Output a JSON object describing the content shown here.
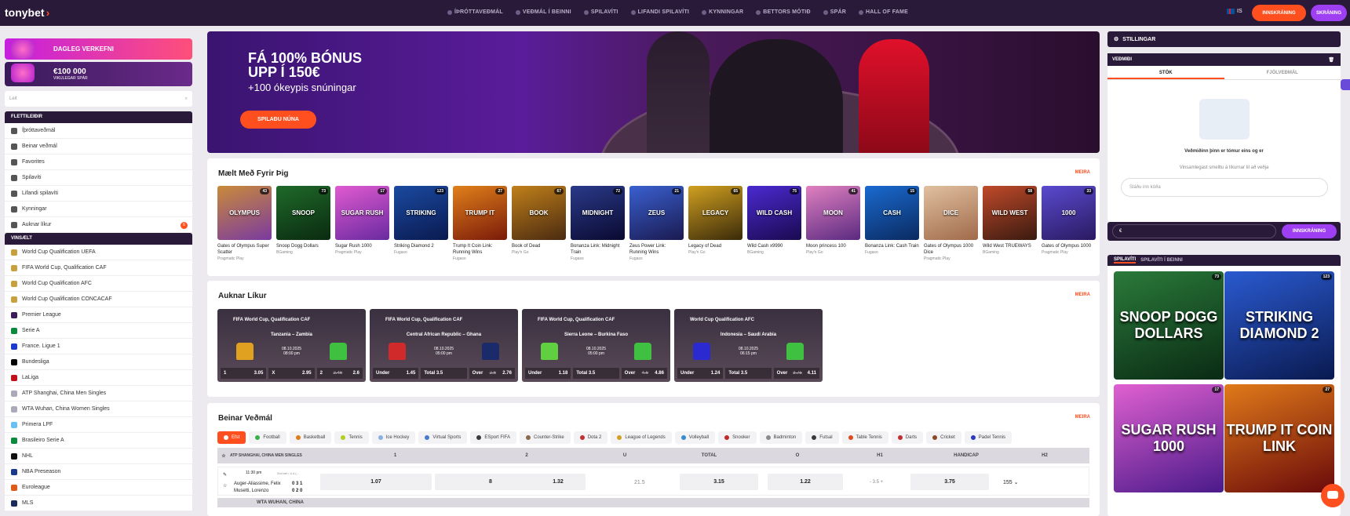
{
  "header": {
    "logo": "tonybet",
    "nav": [
      "ÍÞRÓTTAVEÐMÁL",
      "VEÐMÁL Í BEINNI",
      "SPILAVÍTI",
      "LIFANDI SPILAVÍTI",
      "KYNNINGAR",
      "BETTORS MÓTIÐ",
      "SPÁR",
      "HALL OF FAME"
    ],
    "lang": "IS",
    "login": "INNSKRÁNING",
    "register": "SKRÁNING"
  },
  "left": {
    "promo1": "DAGLEG VERKEFNI",
    "promo2_title": "€100 000",
    "promo2_sub": "VIKULEGAR SPÁR",
    "search_placeholder": "Leit",
    "sec1": "FLETTILEIÐIR",
    "nav_items": [
      "Íþróttaveðmál",
      "Beinar veðmál",
      "Favorites",
      "Spilavíti",
      "Lifandi spilavíti",
      "Kynningar",
      "Auknar líkur"
    ],
    "auknar_count": "6",
    "sec2": "VINSÆLT",
    "popular": [
      "World Cup Qualification UEFA",
      "FIFA World Cup, Qualification CAF",
      "World Cup Qualification AFC",
      "World Cup Qualification CONCACAF",
      "Premier League",
      "Serie A",
      "France. Ligue 1",
      "Bundesliga",
      "LaLiga",
      "ATP Shanghai, China Men Singles",
      "WTA Wuhan, China Women Singles",
      "Primera LPF",
      "Brasileiro Serie A",
      "NHL",
      "NBA Preseason",
      "Euroleague",
      "MLS"
    ]
  },
  "banner": {
    "line1": "FÁ 100% BÓNUS",
    "line2": "UPP Í 150€",
    "line3": "+100 ókeypis snúningar",
    "cta": "SPILAÐU NÚNA"
  },
  "recommended": {
    "title": "Mælt Með Fyrir Þig",
    "more": "MEIRA",
    "games": [
      {
        "name": "Gates of Olympus Super Scatter",
        "prov": "Pragmatic Play",
        "n": "43",
        "art": "OLYMPUS",
        "c1": "#c98a3a",
        "c2": "#7a3aa0"
      },
      {
        "name": "Snoop Dogg Dollars",
        "prov": "BGaming",
        "n": "73",
        "art": "SNOOP",
        "c1": "#1f6a2a",
        "c2": "#0a2a10"
      },
      {
        "name": "Sugar Rush 1000",
        "prov": "Pragmatic Play",
        "n": "17",
        "art": "SUGAR RUSH",
        "c1": "#e05ad0",
        "c2": "#6a2aa0"
      },
      {
        "name": "Striking Diamond 2",
        "prov": "Fugaso",
        "n": "123",
        "art": "STRIKING",
        "c1": "#1a4aa0",
        "c2": "#0a1a50"
      },
      {
        "name": "Trump It Coin Link: Running Wins",
        "prov": "Fugaso",
        "n": "27",
        "art": "TRUMP IT",
        "c1": "#e0801a",
        "c2": "#7a1a0a"
      },
      {
        "name": "Book of Dead",
        "prov": "Play'n Go",
        "n": "67",
        "art": "BOOK",
        "c1": "#c0801a",
        "c2": "#4a2a10"
      },
      {
        "name": "Bonanza Link: Midnight Train",
        "prov": "Fugaso",
        "n": "72",
        "art": "MIDNIGHT",
        "c1": "#2a3a8a",
        "c2": "#0a0a30"
      },
      {
        "name": "Zeus Power Link: Running Wins",
        "prov": "Fugaso",
        "n": "21",
        "art": "ZEUS",
        "c1": "#3a60d0",
        "c2": "#1a1a50"
      },
      {
        "name": "Legacy of Dead",
        "prov": "Play'n Go",
        "n": "65",
        "art": "LEGACY",
        "c1": "#d0a020",
        "c2": "#3a2a0a"
      },
      {
        "name": "Wild Cash x9990",
        "prov": "BGaming",
        "n": "75",
        "art": "WILD CASH",
        "c1": "#4a2ad0",
        "c2": "#1a0a50"
      },
      {
        "name": "Moon princess 100",
        "prov": "Play'n Go",
        "n": "41",
        "art": "MOON",
        "c1": "#e080c0",
        "c2": "#5a2a80"
      },
      {
        "name": "Bonanza Link: Cash Train",
        "prov": "Fugaso",
        "n": "15",
        "art": "CASH",
        "c1": "#1a6ad0",
        "c2": "#0a2a60"
      },
      {
        "name": "Gates of Olympus 1000 Dice",
        "prov": "Pragmatic Play",
        "n": "",
        "art": "DICE",
        "c1": "#e0c0a0",
        "c2": "#a06a4a"
      },
      {
        "name": "Wild West TRUEWAYS",
        "prov": "BGaming",
        "n": "58",
        "art": "WILD WEST",
        "c1": "#c04a2a",
        "c2": "#3a1a10"
      },
      {
        "name": "Gates of Olympus 1000",
        "prov": "Pragmatic Play",
        "n": "33",
        "art": "1000",
        "c1": "#5a4ad0",
        "c2": "#2a1a60"
      }
    ]
  },
  "boosted": {
    "title": "Auknar Líkur",
    "more": "MEIRA",
    "matches": [
      {
        "comp": "FIFA World Cup, Qualification CAF",
        "teams": "Tanzania – Zambia",
        "date": "08.10.2025",
        "time": "08:00 pm",
        "o1l": "1",
        "o1": "3.05",
        "o2l": "X",
        "o2": "2.95",
        "o3l": "2",
        "o3old": "2.46",
        "o3": "2.6",
        "s1": "#e0a020",
        "s2": "#40c040"
      },
      {
        "comp": "FIFA World Cup, Qualification CAF",
        "teams": "Central African Republic – Ghana",
        "date": "08.10.2025",
        "time": "05:00 pm",
        "o1l": "Under",
        "o1": "1.45",
        "o2l": "Total 3.5",
        "o2": "",
        "o3l": "Over",
        "o3old": "2.6",
        "o3": "2.76",
        "s1": "#d02a2a",
        "s2": "#1a2a6a"
      },
      {
        "comp": "FIFA World Cup, Qualification CAF",
        "teams": "Sierra Leone – Burkina Faso",
        "date": "08.10.2025",
        "time": "05:00 pm",
        "o1l": "Under",
        "o1": "1.18",
        "o2l": "Total 3.5",
        "o2": "",
        "o3l": "Over",
        "o3old": "4.6",
        "o3": "4.86",
        "s1": "#60d040",
        "s2": "#40c040"
      },
      {
        "comp": "World Cup Qualification AFC",
        "teams": "Indonesia – Saudi Arabia",
        "date": "08.10.2025",
        "time": "06:15 pm",
        "o1l": "Under",
        "o1": "1.24",
        "o2l": "Total 3.5",
        "o2": "",
        "o3l": "Over",
        "o3old": "3.75",
        "o3": "4.11",
        "s1": "#2a2ad0",
        "s2": "#40c040"
      }
    ]
  },
  "live": {
    "title": "Beinar Veðmál",
    "more": "MEIRA",
    "tabs": [
      "Efst",
      "Football",
      "Basketball",
      "Tennis",
      "Ice Hockey",
      "Virtual Sports",
      "ESport FIFA",
      "Counter-Strike",
      "Dota 2",
      "League of Legends",
      "Volleyball",
      "Snooker",
      "Badminton",
      "Futsal",
      "Table Tennis",
      "Darts",
      "Cricket",
      "Padel Tennis"
    ],
    "header": {
      "league": "ATP SHANGHAI, CHINA MEN SINGLES",
      "c1": "1",
      "c2": "2",
      "c3": "U",
      "c4": "TOTAL",
      "c5": "O",
      "c6": "H1",
      "c7": "HANDICAP",
      "c8": "H2"
    },
    "event": {
      "time": "11:30 pm",
      "set": "2nd set / 4-4 (...",
      "p1": "Auger-Aliassime, Felix",
      "p2": "Musetti, Lorenzo",
      "s1": "0 3 1",
      "s2": "0 2 0",
      "o1": "1.07",
      "o2": "8",
      "u": "1.32",
      "total": "21.5",
      "o": "3.15",
      "h1": "1.22",
      "hcp": "- 3.5 +",
      "h2": "3.75",
      "more": "155"
    },
    "next_league": "WTA WUHAN, CHINA"
  },
  "right": {
    "settings": "STILLINGAR",
    "slip_title": "VEÐMIÐI",
    "tab1": "STÖK",
    "tab2": "FJÖLVEÐMÁL",
    "empty1": "Veðmiðinn þinn er tómur eins og er",
    "empty2": "Vinsamlegast smelltu á líkurnar til að veðja",
    "code_placeholder": "Sláðu inn kóða",
    "currency": "€",
    "login": "INNSKRÁNING",
    "casino_tab1": "SPILAVÍTI",
    "casino_tab2": "SPILAVÍTI Í BEINNI",
    "big": [
      {
        "art": "SNOOP DOGG DOLLARS",
        "n": "73",
        "c1": "#2a7a3a",
        "c2": "#0a2a14"
      },
      {
        "art": "STRIKING DIAMOND 2",
        "n": "123",
        "c1": "#2a5ad0",
        "c2": "#0a1a50"
      },
      {
        "art": "SUGAR RUSH 1000",
        "n": "17",
        "c1": "#e060d0",
        "c2": "#4a1a8a"
      },
      {
        "art": "TRUMP IT COIN LINK",
        "n": "27",
        "c1": "#e07a1a",
        "c2": "#6a0a0a"
      }
    ]
  }
}
